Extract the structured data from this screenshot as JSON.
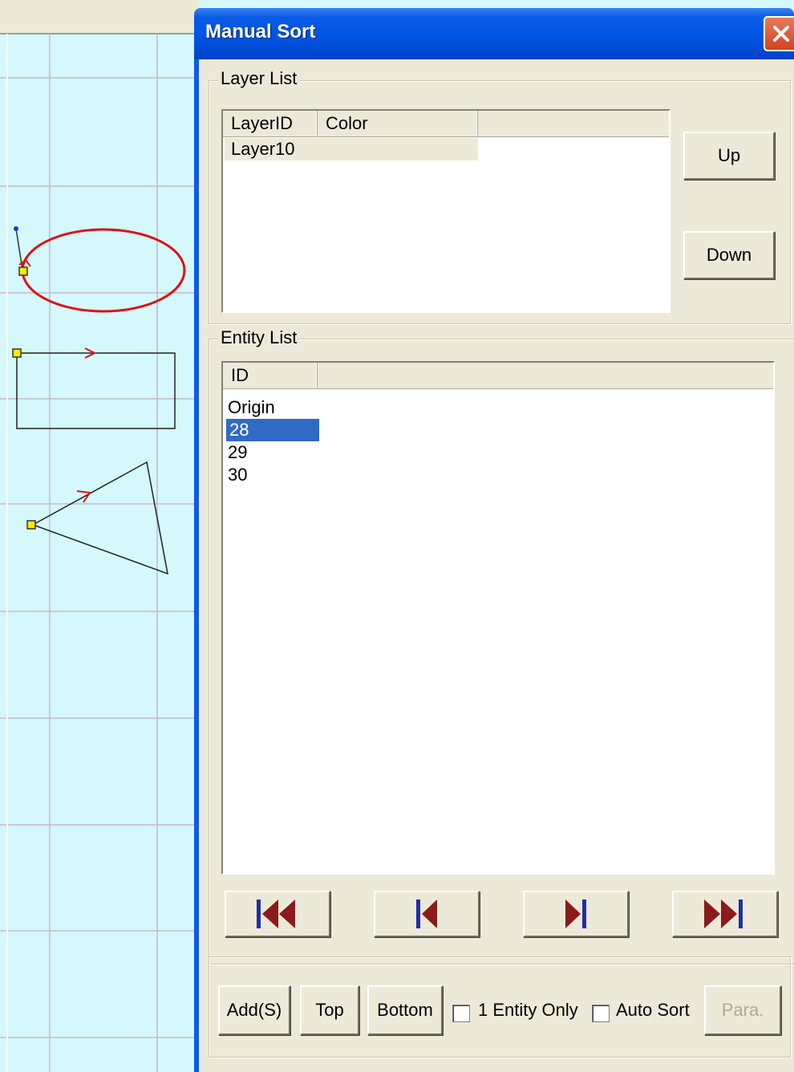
{
  "dialog": {
    "title": "Manual Sort"
  },
  "layer_list": {
    "group_label": "Layer List",
    "columns": [
      "LayerID",
      "Color"
    ],
    "rows": [
      {
        "layer_id": "Layer10",
        "color": ""
      }
    ],
    "up_label": "Up",
    "down_label": "Down"
  },
  "entity_list": {
    "group_label": "Entity List",
    "columns": [
      "ID"
    ],
    "rows": [
      "Origin",
      "28",
      "29",
      "30"
    ],
    "selected_index": 1
  },
  "navigation": {
    "first_icon": "skip-to-first-icon",
    "prev_icon": "step-back-icon",
    "next_icon": "step-forward-icon",
    "last_icon": "skip-to-last-icon"
  },
  "bottom_bar": {
    "add_label": "Add(S)",
    "top_label": "Top",
    "bottom_label": "Bottom",
    "one_entity_only_label": "1 Entity Only",
    "one_entity_only_checked": false,
    "auto_sort_label": "Auto Sort",
    "auto_sort_checked": false,
    "para_label": "Para."
  },
  "colors": {
    "titlebar": "#0054e3",
    "selection": "#316ac5",
    "canvas_bg": "#d4f8fc",
    "grid": "#c9b4d6",
    "ellipse": "#e01010",
    "nav_arrow": "#8b1a1a",
    "nav_bar": "#1f2fa8"
  }
}
